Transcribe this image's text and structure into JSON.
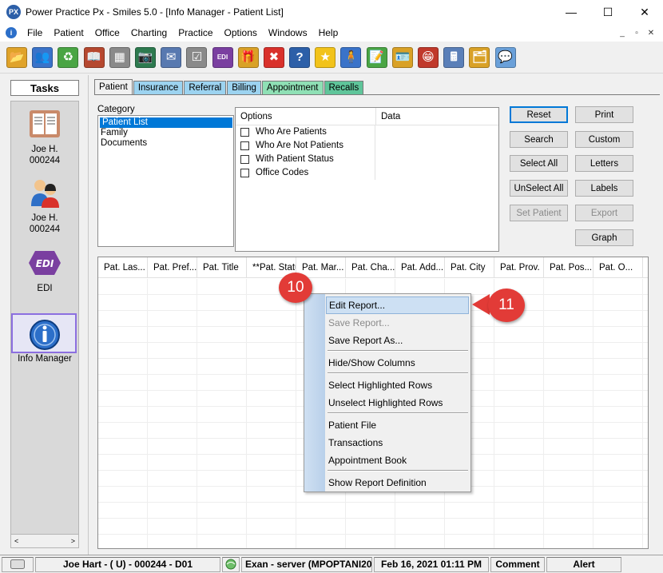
{
  "window": {
    "logo": "PX",
    "title": "Power Practice Px - Smiles 5.0 - [Info Manager - Patient List]",
    "minimize": "—",
    "maximize": "☐",
    "close": "✕"
  },
  "menu": {
    "items": [
      "File",
      "Patient",
      "Office",
      "Charting",
      "Practice",
      "Options",
      "Windows",
      "Help"
    ],
    "mdi": [
      "_",
      "▫",
      "✕"
    ]
  },
  "toolbar": {
    "buttons": [
      {
        "icon": "open-folder-icon",
        "glyph": "📂"
      },
      {
        "icon": "patients-icon",
        "glyph": "👥"
      },
      {
        "icon": "recycle-icon",
        "glyph": "♻"
      },
      {
        "icon": "book-icon",
        "glyph": "📖"
      },
      {
        "icon": "calendar-grid-icon",
        "glyph": "▦"
      },
      {
        "icon": "camera-icon",
        "glyph": "📷"
      },
      {
        "icon": "mail-icon",
        "glyph": "✉"
      },
      {
        "icon": "checklist-icon",
        "glyph": "☑"
      },
      {
        "icon": "edi-icon",
        "glyph": "EDI"
      },
      {
        "icon": "bag-icon",
        "glyph": "🎁"
      },
      {
        "icon": "close-red-icon",
        "glyph": "✖"
      },
      {
        "icon": "help-icon",
        "glyph": "?"
      },
      {
        "icon": "star-icon",
        "glyph": "★"
      },
      {
        "icon": "person-icon",
        "glyph": "🧍"
      },
      {
        "icon": "note-icon",
        "glyph": "📝"
      },
      {
        "icon": "id-card-icon",
        "glyph": "🪪"
      },
      {
        "icon": "smile-folder-icon",
        "glyph": "😁"
      },
      {
        "icon": "calculator-icon",
        "glyph": "🖩"
      },
      {
        "icon": "folders-icon",
        "glyph": "🗂"
      },
      {
        "icon": "chat-bubble-icon",
        "glyph": "💬"
      }
    ]
  },
  "tasks": {
    "title": "Tasks",
    "items": [
      {
        "line1": "Joe H.",
        "line2": "000244",
        "icon": "patient-chart-icon"
      },
      {
        "line1": "Joe H.",
        "line2": "000244",
        "icon": "family-icon"
      },
      {
        "line1": "EDI",
        "line2": "",
        "icon": "edi-icon"
      },
      {
        "line1": "Info Manager",
        "line2": "",
        "icon": "info-manager-icon"
      }
    ],
    "scroll_left": "<",
    "scroll_right": ">"
  },
  "tabs": [
    "Patient",
    "Insurance",
    "Referral",
    "Billing",
    "Appointment",
    "Recalls"
  ],
  "tab_colors": [
    "#f0f0f0",
    "#9cd3f0",
    "#9cd3f0",
    "#9cd3f0",
    "#8fe0b5",
    "#5fc59a"
  ],
  "category": {
    "label": "Category",
    "items": [
      "Patient List",
      "Family",
      "Documents"
    ],
    "selected": "Patient List"
  },
  "options": {
    "header_options": "Options",
    "header_data": "Data",
    "items": [
      "Who Are Patients",
      "Who Are Not Patients",
      "With Patient Status",
      "Office Codes"
    ]
  },
  "buttons": {
    "reset": "Reset",
    "print": "Print",
    "search": "Search",
    "custom": "Custom",
    "select_all": "Select All",
    "letters": "Letters",
    "unselect_all": "UnSelect All",
    "labels": "Labels",
    "set_patient": "Set Patient",
    "export": "Export",
    "graph": "Graph"
  },
  "grid": {
    "columns": [
      "Pat. Las...",
      "Pat. Pref...",
      "Pat. Title",
      "**Pat. Status",
      "Pat. Mar...",
      "Pat. Cha...",
      "Pat. Add...",
      "Pat. City",
      "Pat. Prov.",
      "Pat. Pos...",
      "Pat. O..."
    ]
  },
  "context_menu": {
    "edit_report": "Edit Report...",
    "save_report": "Save Report...",
    "save_report_as": "Save Report As...",
    "hide_show_columns": "Hide/Show Columns",
    "select_highlighted": "Select Highlighted Rows",
    "unselect_highlighted": "Unselect Highlighted Rows",
    "patient_file": "Patient File",
    "transactions": "Transactions",
    "appointment_book": "Appointment Book",
    "show_report_definition": "Show Report Definition"
  },
  "callouts": {
    "step10": "10",
    "step11": "11"
  },
  "statusbar": {
    "patient": "Joe Hart - ( U) - 000244 - D01",
    "server": "Exan - server (MPOPTANI20",
    "datetime": "Feb 16, 2021 01:11 PM",
    "comment": "Comment",
    "alert": "Alert"
  },
  "colors": {
    "accent": "#0078d7",
    "callout": "#e23b37",
    "selection_frame": "#8c6fe0"
  }
}
